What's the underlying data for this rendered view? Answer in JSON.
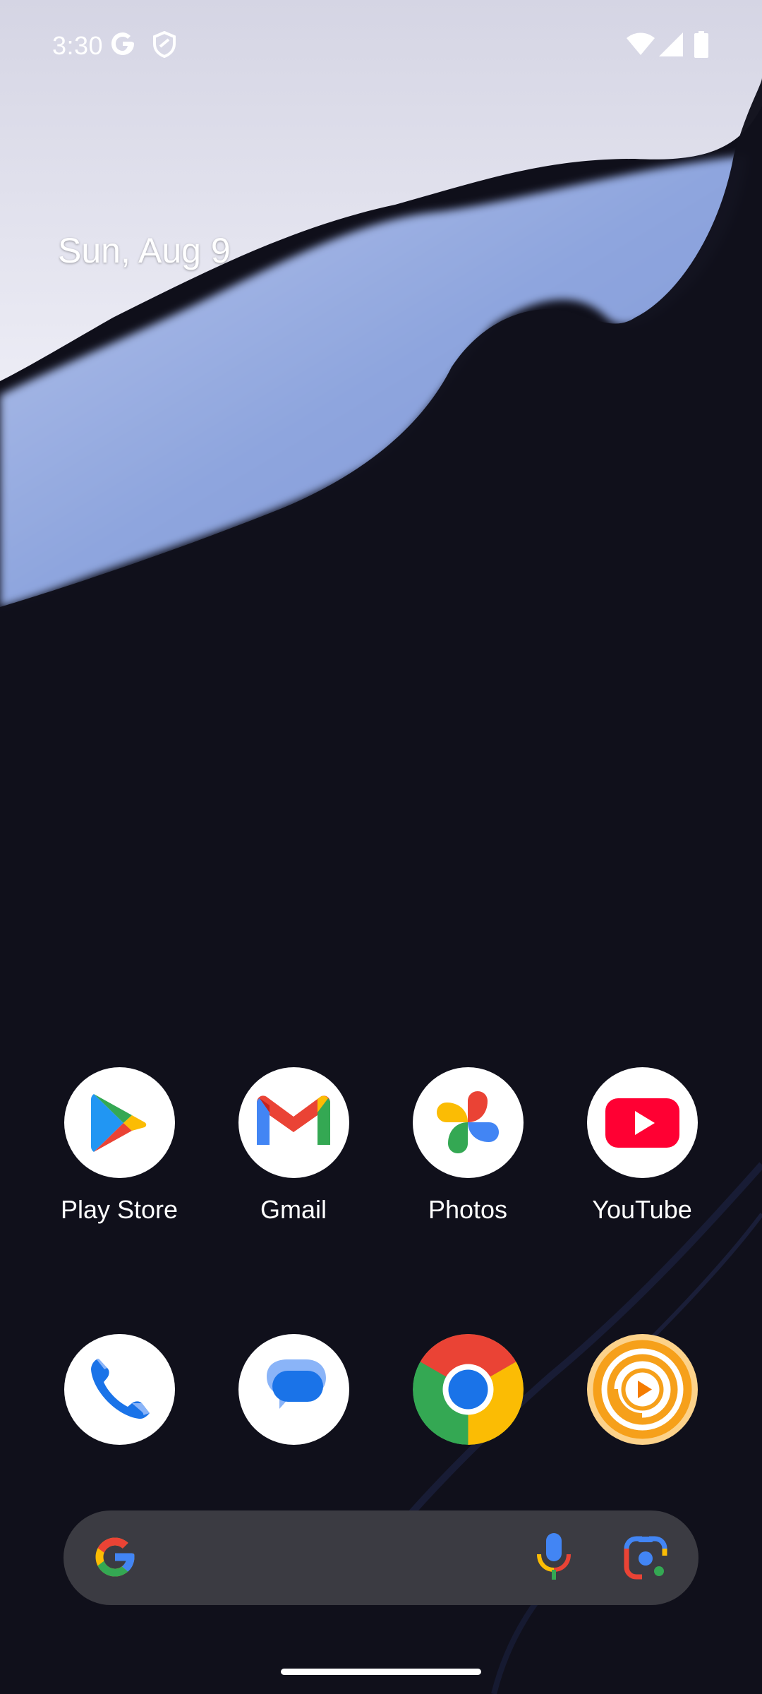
{
  "status_bar": {
    "time": "3:30",
    "left_icons": [
      "google-g-icon",
      "shield-icon"
    ],
    "right_icons": [
      "wifi-icon",
      "cellular-signal-icon",
      "battery-icon"
    ]
  },
  "home": {
    "date": "Sun, Aug 9"
  },
  "apps_row1": [
    {
      "label": "Play Store",
      "icon": "play-store-icon"
    },
    {
      "label": "Gmail",
      "icon": "gmail-icon"
    },
    {
      "label": "Photos",
      "icon": "photos-icon"
    },
    {
      "label": "YouTube",
      "icon": "youtube-icon"
    }
  ],
  "dock": [
    {
      "icon": "phone-icon"
    },
    {
      "icon": "messages-icon"
    },
    {
      "icon": "chrome-icon"
    },
    {
      "icon": "podcast-player-icon"
    }
  ],
  "search_bar": {
    "icons": [
      "google-g-icon",
      "microphone-icon",
      "google-lens-icon"
    ]
  },
  "colors": {
    "wallpaper_dark": "#0f0f1a",
    "wallpaper_blue": "#8fa6dd",
    "wallpaper_light": "#e6e6f2",
    "search_bg": "#3b3b42",
    "google_blue": "#4285F4",
    "google_red": "#EA4335",
    "google_yellow": "#FBBC04",
    "google_green": "#34A853"
  }
}
